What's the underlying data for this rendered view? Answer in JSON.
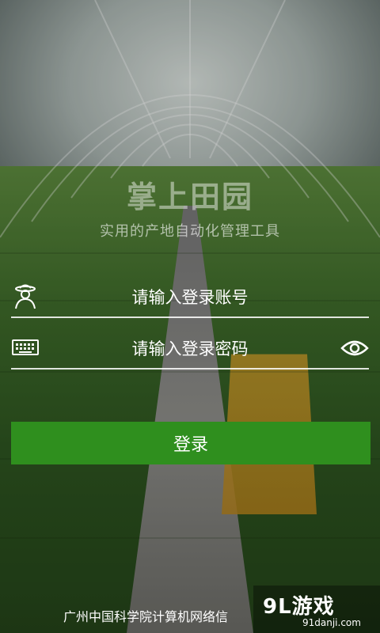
{
  "app": {
    "title": "掌上田园",
    "subtitle": "实用的产地自动化管理工具"
  },
  "login_form": {
    "username_placeholder": "请输入登录账号",
    "password_placeholder": "请输入登录密码",
    "submit_label": "登录"
  },
  "footer": {
    "text": "广州中国科学院计算机网络信"
  },
  "watermark": {
    "logo_text": "9L游戏",
    "site_text": "91danji.com"
  },
  "icons": {
    "user": "farmer-icon",
    "password": "keyboard-icon",
    "show_password": "eye-icon"
  },
  "colors": {
    "accent": "#2f8f1e",
    "text": "#ffffff"
  }
}
